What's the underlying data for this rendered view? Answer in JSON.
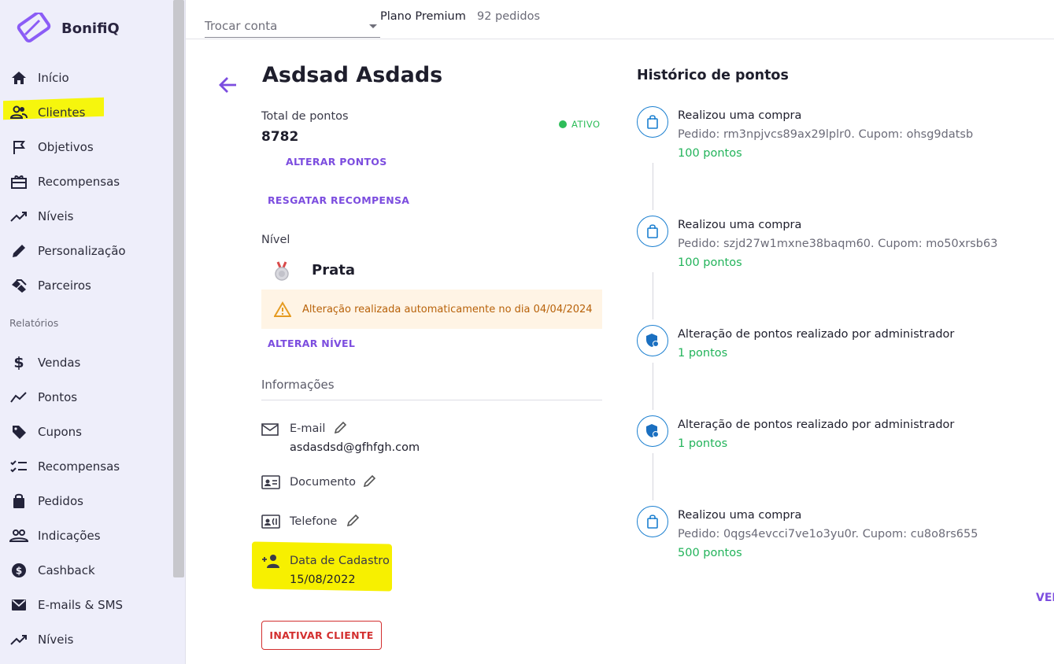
{
  "brand": {
    "name": "BonifiQ",
    "accent": "#7c4ddf"
  },
  "sidebar": {
    "items": [
      {
        "label": "Início",
        "icon": "home-icon"
      },
      {
        "label": "Clientes",
        "icon": "users-icon"
      },
      {
        "label": "Objetivos",
        "icon": "flag-icon"
      },
      {
        "label": "Recompensas",
        "icon": "gift-icon"
      },
      {
        "label": "Níveis",
        "icon": "trend-icon"
      },
      {
        "label": "Personalização",
        "icon": "pencil-icon"
      },
      {
        "label": "Parceiros",
        "icon": "handshake-icon"
      }
    ],
    "section": "Relatórios",
    "report_items": [
      {
        "label": "Vendas",
        "icon": "dollar-icon"
      },
      {
        "label": "Pontos",
        "icon": "trend-icon"
      },
      {
        "label": "Cupons",
        "icon": "tag-icon"
      },
      {
        "label": "Recompensas",
        "icon": "checklist-icon"
      },
      {
        "label": "Pedidos",
        "icon": "bag-icon"
      },
      {
        "label": "Indicações",
        "icon": "people-icon"
      },
      {
        "label": "Cashback",
        "icon": "cashback-icon"
      },
      {
        "label": "E-mails & SMS",
        "icon": "mail-icon"
      },
      {
        "label": "Níveis",
        "icon": "trend-icon"
      }
    ]
  },
  "topbar": {
    "account_placeholder": "Trocar conta",
    "plan": "Plano Premium",
    "orders": "92 pedidos"
  },
  "client": {
    "name": "Asdsad Asdads",
    "points_label": "Total de pontos",
    "points": "8782",
    "status": "ATIVO",
    "alter_points": "ALTERAR PONTOS",
    "redeem": "RESGATAR RECOMPENSA",
    "level_label": "Nível",
    "level": "Prata",
    "alert": "Alteração realizada automaticamente no dia 04/04/2024",
    "alter_level": "ALTERAR NÍVEL",
    "info_label": "Informações",
    "email_label": "E-mail",
    "email": "asdasdsd@gfhfgh.com",
    "document_label": "Documento",
    "phone_label": "Telefone",
    "signup_label": "Data de Cadastro",
    "signup_date": "15/08/2022",
    "inactivate": "INATIVAR CLIENTE"
  },
  "history": {
    "title": "Histórico de pontos",
    "events": [
      {
        "title": "Realizou uma compra",
        "desc": "Pedido: rm3npjvcs89ax29lplr0. Cupom: ohsg9datsb",
        "points": "100 pontos",
        "icon": "bag-icon"
      },
      {
        "title": "Realizou uma compra",
        "desc": "Pedido: szjd27w1mxne38baqm60. Cupom: mo50xrsb63",
        "points": "100 pontos",
        "icon": "bag-icon"
      },
      {
        "title": "Alteração de pontos realizado por administrador",
        "desc": "",
        "points": "1 pontos",
        "icon": "shield-user-icon"
      },
      {
        "title": "Alteração de pontos realizado por administrador",
        "desc": "",
        "points": "1 pontos",
        "icon": "shield-user-icon"
      },
      {
        "title": "Realizou uma compra",
        "desc": "Pedido: 0qgs4evcci7ve1o3yu0r. Cupom: cu8o8rs655",
        "points": "500 pontos",
        "icon": "bag-icon"
      }
    ],
    "more": "VER"
  }
}
